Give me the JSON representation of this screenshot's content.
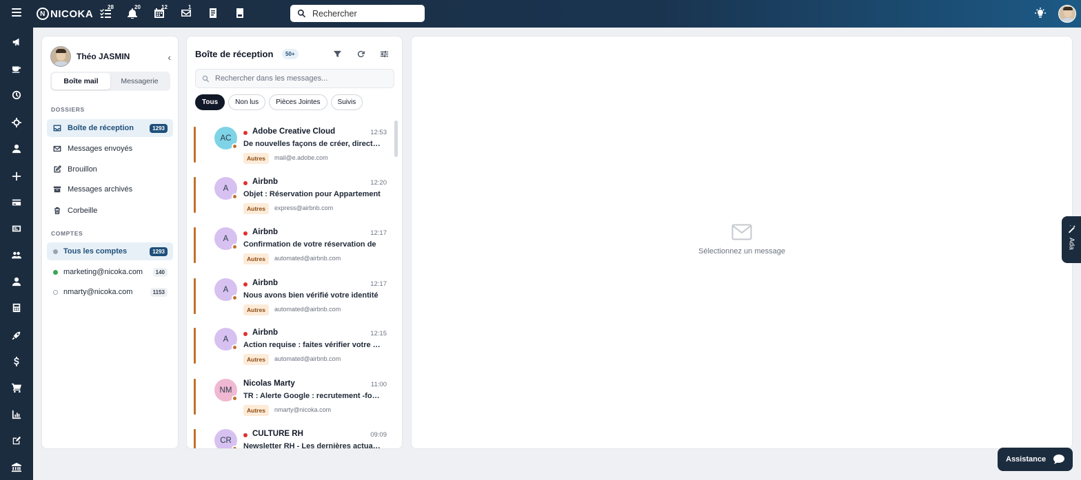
{
  "app": {
    "name": "NICOKA"
  },
  "topbar": {
    "search_placeholder": "Rechercher",
    "badges": {
      "tasks": "28",
      "notifications": "20",
      "calendar": "12",
      "mail": "1"
    },
    "icons": [
      "menu-icon",
      "tasks-icon",
      "bell-icon",
      "calendar-icon",
      "mail-icon",
      "notes-icon",
      "document-icon",
      "bulb-icon"
    ]
  },
  "rail": {
    "icons": [
      "megaphone-icon",
      "coffee-icon",
      "dashboard-icon",
      "target-icon",
      "user-icon",
      "plus-icon",
      "card-icon",
      "id-card-icon",
      "team-icon",
      "person-icon",
      "calculator-icon",
      "rocket-icon",
      "dollar-icon",
      "cart-icon",
      "chart-icon",
      "edit-icon",
      "bank-icon"
    ]
  },
  "left_panel": {
    "user_name": "Théo JASMIN",
    "tabs": [
      {
        "label": "Boîte mail",
        "active": true
      },
      {
        "label": "Messagerie",
        "active": false
      }
    ],
    "folders_title": "DOSSIERS",
    "folders": [
      {
        "label": "Boîte de réception",
        "count": "1293",
        "icon": "inbox-icon",
        "active": true
      },
      {
        "label": "Messages envoyés",
        "count": "",
        "icon": "mail-icon",
        "active": false
      },
      {
        "label": "Brouillon",
        "count": "",
        "icon": "edit-icon",
        "active": false
      },
      {
        "label": "Messages archivés",
        "count": "",
        "icon": "archive-icon",
        "active": false
      },
      {
        "label": "Corbeille",
        "count": "",
        "icon": "trash-icon",
        "active": false
      }
    ],
    "accounts_title": "COMPTES",
    "accounts": [
      {
        "label": "Tous les comptes",
        "count": "1293",
        "color": "#9ca3af",
        "active": true
      },
      {
        "label": "marketing@nicoka.com",
        "count": "140",
        "color": "#3aa853",
        "active": false
      },
      {
        "label": "nmarty@nicoka.com",
        "count": "1153",
        "color": "#ffffff",
        "active": false
      }
    ]
  },
  "inbox": {
    "title": "Boîte de réception",
    "badge": "50+",
    "search_placeholder": "Rechercher dans les messages...",
    "filters": [
      {
        "label": "Tous",
        "active": true
      },
      {
        "label": "Non lus",
        "active": false
      },
      {
        "label": "Pièces Jointes",
        "active": false
      },
      {
        "label": "Suivis",
        "active": false
      }
    ],
    "messages": [
      {
        "initials": "AC",
        "from": "Adobe Creative Cloud",
        "time": "12:53",
        "subject": "De nouvelles façons de créer, directement",
        "tag": "Autres",
        "address": "mail@e.adobe.com",
        "avatar_bg": "#7fd3e6",
        "unread": true
      },
      {
        "initials": "A",
        "from": "Airbnb",
        "time": "12:20",
        "subject": "Objet : Réservation pour Appartement",
        "tag": "Autres",
        "address": "express@airbnb.com",
        "avatar_bg": "#d7c1f0",
        "unread": true
      },
      {
        "initials": "A",
        "from": "Airbnb",
        "time": "12:17",
        "subject": "Confirmation de votre réservation de",
        "tag": "Autres",
        "address": "automated@airbnb.com",
        "avatar_bg": "#d7c1f0",
        "unread": true
      },
      {
        "initials": "A",
        "from": "Airbnb",
        "time": "12:17",
        "subject": "Nous avons bien vérifié votre identité",
        "tag": "Autres",
        "address": "automated@airbnb.com",
        "avatar_bg": "#d7c1f0",
        "unread": true
      },
      {
        "initials": "A",
        "from": "Airbnb",
        "time": "12:15",
        "subject": "Action requise : faites vérifier votre identité",
        "tag": "Autres",
        "address": "automated@airbnb.com",
        "avatar_bg": "#d7c1f0",
        "unread": true
      },
      {
        "initials": "NM",
        "from": "Nicolas Marty",
        "time": "11:00",
        "subject": "TR : Alerte Google : recrutement -formation",
        "tag": "Autres",
        "address": "nmarty@nicoka.com",
        "avatar_bg": "#f0b8d2",
        "unread": false
      },
      {
        "initials": "CR",
        "from": "CULTURE RH",
        "time": "09:09",
        "subject": "Newsletter RH - Les dernières actualités",
        "tag": "Autres",
        "address": "",
        "avatar_bg": "#d7c1f0",
        "unread": true
      }
    ]
  },
  "preview": {
    "empty_text": "Sélectionnez un message"
  },
  "ada": {
    "label": "Ada"
  },
  "assistance": {
    "label": "Assistance"
  }
}
